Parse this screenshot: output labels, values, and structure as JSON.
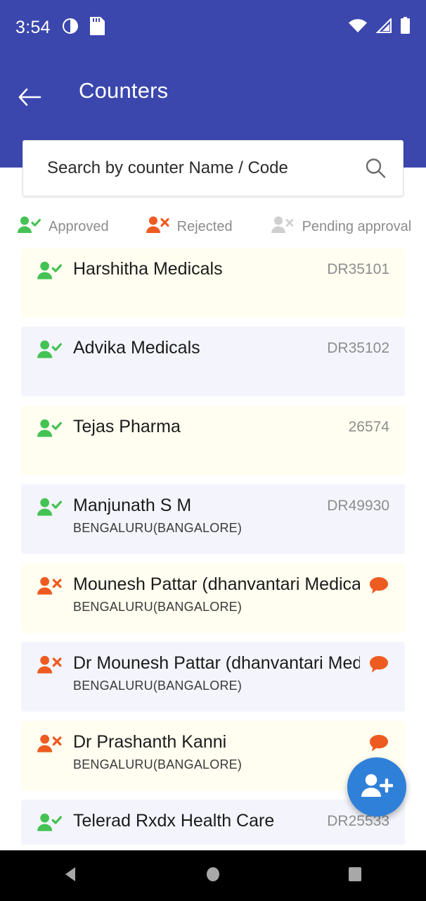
{
  "statusbar": {
    "time": "3:54",
    "icons": [
      "dnd-icon",
      "sd-card-icon",
      "wifi-icon",
      "cellular-signal-icon",
      "battery-icon"
    ]
  },
  "appbar": {
    "back_label": "back-arrow-icon",
    "title": "Counters"
  },
  "search": {
    "placeholder": "Search by counter Name / Code",
    "value": "",
    "icon": "search-icon"
  },
  "legend": [
    {
      "label": "Approved",
      "status": "approved",
      "color": "#44C254"
    },
    {
      "label": "Rejected",
      "status": "rejected",
      "color": "#EE5B21"
    },
    {
      "label": "Pending approval",
      "status": "pending",
      "color": "#CFCFCF"
    }
  ],
  "colors": {
    "header_blue": "#3B47AD",
    "approved_green": "#44C254",
    "rejected_orange": "#EE5B21",
    "pending_grey": "#CFCFCF",
    "fab_blue": "#2F80D8",
    "card_cream": "#FFFEF0",
    "card_lavender": "#F4F5FC"
  },
  "counters": [
    {
      "name": "Harshitha Medicals",
      "city": "",
      "code": "DR35101",
      "status": "approved",
      "has_chat": false,
      "bg": "cream"
    },
    {
      "name": "Advika Medicals",
      "city": "",
      "code": "DR35102",
      "status": "approved",
      "has_chat": false,
      "bg": "lav"
    },
    {
      "name": "Tejas Pharma",
      "city": "",
      "code": "26574",
      "status": "approved",
      "has_chat": false,
      "bg": "cream"
    },
    {
      "name": "Manjunath S M",
      "city": "BENGALURU(BANGALORE)",
      "code": "DR49930",
      "status": "approved",
      "has_chat": false,
      "bg": "lav"
    },
    {
      "name": "Mounesh Pattar (dhanvantari Medicals)",
      "city": "BENGALURU(BANGALORE)",
      "code": "",
      "status": "rejected",
      "has_chat": true,
      "bg": "cream"
    },
    {
      "name": "Dr Mounesh Pattar (dhanvantari Medicals)",
      "city": "BENGALURU(BANGALORE)",
      "code": "",
      "status": "rejected",
      "has_chat": true,
      "bg": "lav"
    },
    {
      "name": "Dr Prashanth Kanni",
      "city": "BENGALURU(BANGALORE)",
      "code": "",
      "status": "rejected",
      "has_chat": true,
      "bg": "cream"
    },
    {
      "name": "Telerad Rxdx Health Care",
      "city": "",
      "code": "DR25533",
      "status": "approved",
      "has_chat": false,
      "bg": "lav"
    }
  ],
  "fab": {
    "label": "add-counter",
    "icon": "person-add-icon"
  },
  "navbar": {
    "back": "nav-back-icon",
    "home": "nav-home-icon",
    "recents": "nav-recents-icon"
  }
}
